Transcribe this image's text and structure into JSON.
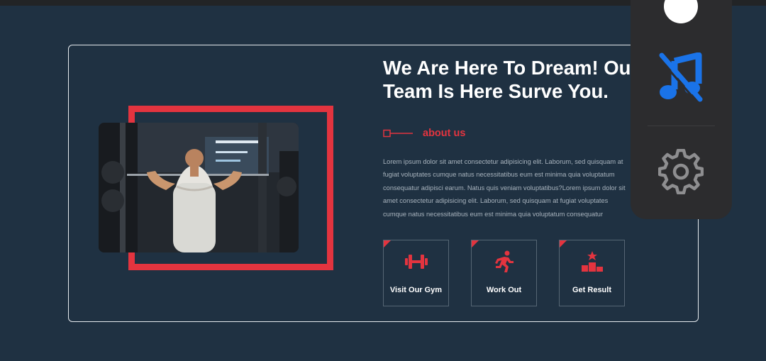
{
  "hero": {
    "heading_line1": "We Are Here To Dream! Our",
    "heading_line2": "Team Is Here Surve You.",
    "about_label": "about us",
    "paragraph": "Lorem ipsum dolor sit amet consectetur adipisicing elit. Laborum, sed quisquam at fugiat voluptates cumque natus necessitatibus eum est minima quia voluptatum consequatur adipisci earum. Natus quis veniam voluptatibus?Lorem ipsum dolor sit amet consectetur adipisicing elit. Laborum, sed quisquam at fugiat voluptates cumque natus necessitatibus eum est minima quia voluptatum consequatur"
  },
  "features": [
    {
      "label": "Visit Our Gym",
      "icon": "dumbbell-icon"
    },
    {
      "label": "Work Out",
      "icon": "running-person-icon"
    },
    {
      "label": "Get Result",
      "icon": "podium-icon"
    }
  ],
  "overlay": {
    "items": [
      "white-dot",
      "music-off-icon",
      "gear-icon"
    ]
  },
  "colors": {
    "background": "#1f3142",
    "accent": "#e3343f",
    "overlay_bg": "#2c2c2e",
    "music_icon": "#1a73e8"
  }
}
